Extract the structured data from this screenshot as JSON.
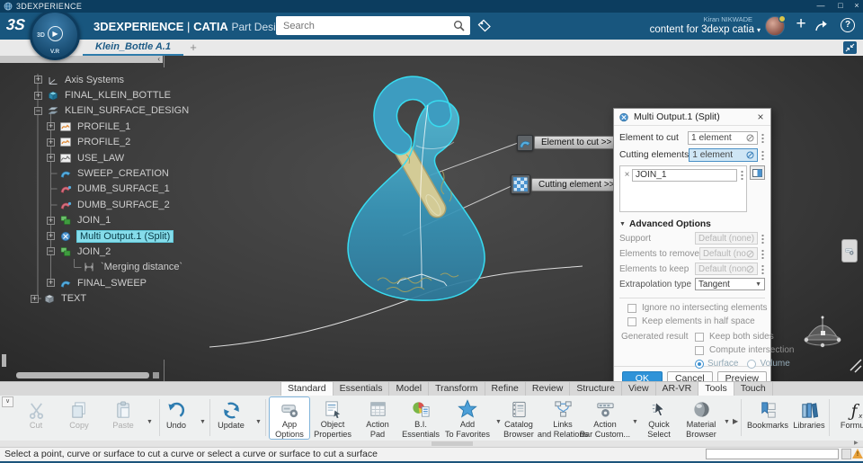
{
  "titlebar": {
    "app_title": "3DEXPERIENCE",
    "minimize": "—",
    "maximize": "□",
    "close": "×"
  },
  "header": {
    "brand": "3DEXPERIENCE",
    "divider": "|",
    "app": "CATIA",
    "module": "Part Design",
    "search_placeholder": "Search",
    "user_name": "Kiran NIKWADE",
    "workspace": "content for 3dexp catia",
    "compass_3d": "3D",
    "compass_play": "▶",
    "compass_vr": "V.R",
    "add": "+",
    "help": "?"
  },
  "tabbar": {
    "active_tab": "Klein_Bottle A.1",
    "new_tab": "+"
  },
  "tree": {
    "items": [
      {
        "label": "Axis Systems",
        "exp": "+"
      },
      {
        "label": "FINAL_KLEIN_BOTTLE",
        "exp": "+"
      },
      {
        "label": "KLEIN_SURFACE_DESIGN",
        "exp": "−"
      },
      {
        "label": "PROFILE_1",
        "exp": "+"
      },
      {
        "label": "PROFILE_2",
        "exp": "+"
      },
      {
        "label": "USE_LAW",
        "exp": "+"
      },
      {
        "label": "SWEEP_CREATION",
        "exp": ""
      },
      {
        "label": "DUMB_SURFACE_1",
        "exp": ""
      },
      {
        "label": "DUMB_SURFACE_2",
        "exp": ""
      },
      {
        "label": "JOIN_1",
        "exp": "+"
      },
      {
        "label": "Multi Output.1 (Split)",
        "exp": "+"
      },
      {
        "label": "JOIN_2",
        "exp": "−"
      },
      {
        "label": "`Merging distance`",
        "exp": ""
      },
      {
        "label": "FINAL_SWEEP",
        "exp": "+"
      },
      {
        "label": "TEXT",
        "exp": "+"
      }
    ]
  },
  "viewport": {
    "callout_element": "Element to cut >>",
    "callout_cutting": "Cutting element >>"
  },
  "dialog": {
    "title": "Multi Output.1 (Split)",
    "close": "×",
    "element_to_cut_label": "Element to cut",
    "element_to_cut_value": "1 element",
    "cutting_elements_label": "Cutting elements",
    "cutting_elements_value": "1 element",
    "list_item_remove": "×",
    "list_item_name": "JOIN_1",
    "advanced_title": "Advanced Options",
    "support_label": "Support",
    "support_value": "Default (none)",
    "remove_label": "Elements to remove",
    "remove_value": "Default (none)",
    "keep_label": "Elements to keep",
    "keep_value": "Default (none)",
    "extrapolation_label": "Extrapolation type",
    "extrapolation_value": "Tangent",
    "cb_ignore": "Ignore no intersecting elements",
    "cb_halfspace": "Keep elements in half space",
    "generated_label": "Generated result",
    "cb_both": "Keep both sides",
    "cb_intersection": "Compute intersection",
    "radio_surface": "Surface",
    "radio_volume": "Volume",
    "ok": "OK",
    "cancel": "Cancel",
    "preview": "Preview"
  },
  "ribbon": {
    "tabs": [
      "Standard",
      "Essentials",
      "Model",
      "Transform",
      "Refine",
      "Review",
      "Structure",
      "View",
      "AR-VR",
      "Tools",
      "Touch"
    ]
  },
  "toolbar": {
    "buttons": [
      {
        "l1": "Cut"
      },
      {
        "l1": "Copy"
      },
      {
        "l1": "Paste"
      },
      {
        "l1": "Undo"
      },
      {
        "l1": "Update"
      },
      {
        "l1": "App",
        "l2": "Options"
      },
      {
        "l1": "Object",
        "l2": "Properties"
      },
      {
        "l1": "Action",
        "l2": "Pad"
      },
      {
        "l1": "B.I.",
        "l2": "Essentials"
      },
      {
        "l1": "Add",
        "l2": "To Favorites"
      },
      {
        "l1": "Catalog",
        "l2": "Browser"
      },
      {
        "l1": "Links",
        "l2": "and Relations"
      },
      {
        "l1": "Action",
        "l2": "Bar Custom..."
      },
      {
        "l1": "Quick",
        "l2": "Select"
      },
      {
        "l1": "Material",
        "l2": "Browser"
      },
      {
        "l1": "Bookmarks"
      },
      {
        "l1": "Libraries"
      },
      {
        "l1": "Formu..."
      }
    ]
  },
  "statusbar": {
    "message": "Select a point, curve or surface to cut a curve or select a curve or surface to cut a surface"
  },
  "colors": {
    "accent_blue": "#2f93d8",
    "header_blue": "#18567e",
    "selection_cyan": "#85dcea",
    "model_teal": "#3d9cc0",
    "warning_orange": "#e9a23c"
  }
}
